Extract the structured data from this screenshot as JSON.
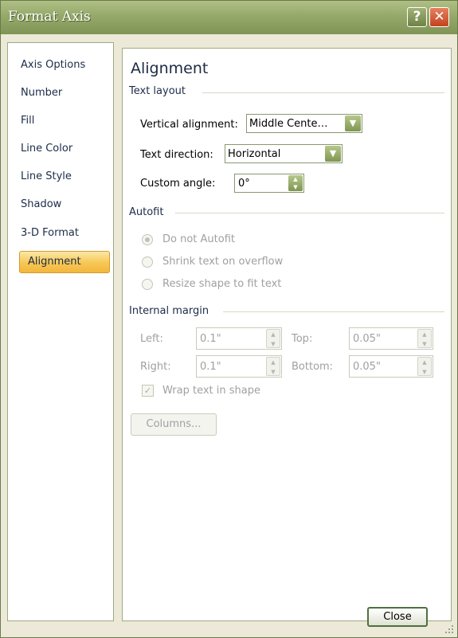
{
  "window": {
    "title": "Format Axis",
    "help_glyph": "?",
    "close_glyph": "✕"
  },
  "sidebar": {
    "items": [
      {
        "label": "Axis Options"
      },
      {
        "label": "Number"
      },
      {
        "label": "Fill"
      },
      {
        "label": "Line Color"
      },
      {
        "label": "Line Style"
      },
      {
        "label": "Shadow"
      },
      {
        "label": "3-D Format"
      },
      {
        "label": "Alignment",
        "selected": true
      }
    ]
  },
  "main": {
    "heading": "Alignment",
    "text_layout": {
      "group_label": "Text layout",
      "vertical_alignment": {
        "label": "Vertical alignment:",
        "value": "Middle Cente…"
      },
      "text_direction": {
        "label": "Text direction:",
        "value": "Horizontal"
      },
      "custom_angle": {
        "label": "Custom angle:",
        "value": "0°"
      }
    },
    "autofit": {
      "group_label": "Autofit",
      "options": [
        {
          "label": "Do not Autofit",
          "selected": true
        },
        {
          "label": "Shrink text on overflow",
          "selected": false
        },
        {
          "label": "Resize shape to fit text",
          "selected": false
        }
      ]
    },
    "internal_margin": {
      "group_label": "Internal margin",
      "left": {
        "label": "Left:",
        "value": "0.1\""
      },
      "top": {
        "label": "Top:",
        "value": "0.05\""
      },
      "right": {
        "label": "Right:",
        "value": "0.1\""
      },
      "bottom": {
        "label": "Bottom:",
        "value": "0.05\""
      },
      "wrap_text": {
        "label": "Wrap text in shape",
        "checked": true
      },
      "columns_button": "Columns..."
    }
  },
  "footer": {
    "close_label": "Close"
  },
  "colors": {
    "titlebar": "#95a96a",
    "selected_item": "#f7c95a",
    "dialog_bg": "#ece9d8"
  },
  "icons": {
    "dropdown": "chevron-down-icon",
    "spinner": "spinner-arrows-icon",
    "help": "help-icon",
    "close": "close-icon"
  }
}
